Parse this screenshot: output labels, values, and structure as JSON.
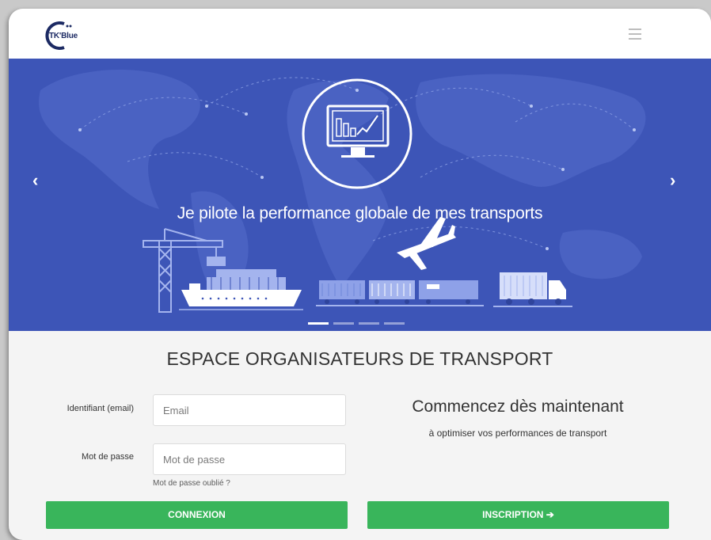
{
  "navbar": {
    "logo_text": "TK'Blue"
  },
  "hero": {
    "title": "Je pilote la performance globale de mes transports",
    "prev_arrow": "‹",
    "next_arrow": "›",
    "slides_count": 4,
    "active_slide": 1,
    "colors": {
      "background": "#3d55b7",
      "illustration": "#9fb0ea"
    }
  },
  "section": {
    "title": "ESPACE ORGANISATEURS DE TRANSPORT"
  },
  "login": {
    "email_label": "Identifiant (email)",
    "email_placeholder": "Email",
    "password_label": "Mot de passe",
    "password_placeholder": "Mot de passe",
    "forgot_link": "Mot de passe oublié ?",
    "submit_label": "CONNEXION"
  },
  "signup": {
    "heading": "Commencez dès maintenant",
    "subheading": "à optimiser vos performances de transport",
    "button_label": "INSCRIPTION ➔"
  },
  "colors": {
    "primary_button": "#39b55b"
  }
}
